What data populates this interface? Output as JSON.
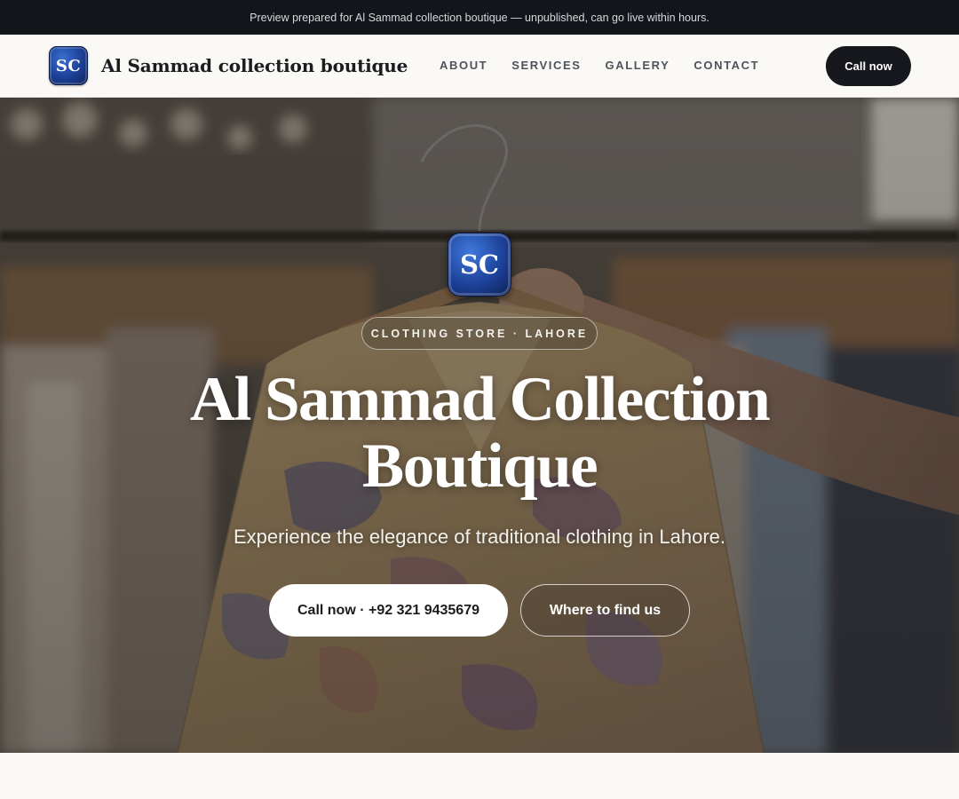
{
  "banner": {
    "text": "Preview prepared for Al Sammad collection boutique — unpublished, can go live within hours."
  },
  "header": {
    "logo_text": "SC",
    "brand_name": "Al Sammad collection boutique",
    "nav": [
      {
        "label": "ABOUT"
      },
      {
        "label": "SERVICES"
      },
      {
        "label": "GALLERY"
      },
      {
        "label": "CONTACT"
      }
    ],
    "call_label": "Call now"
  },
  "hero": {
    "logo_text": "SC",
    "tag": "CLOTHING STORE · LAHORE",
    "title_line1": "Al Sammad Collection",
    "title_line2": "Boutique",
    "subtitle": "Experience the elegance of traditional clothing in Lahore.",
    "primary_button": "Call now · +92 321 9435679",
    "secondary_button": "Where to find us"
  },
  "colors": {
    "banner_bg": "#12151a",
    "header_bg": "#faf9f6",
    "call_button_bg": "#16181d",
    "logo_blue": "#1c3f95"
  }
}
